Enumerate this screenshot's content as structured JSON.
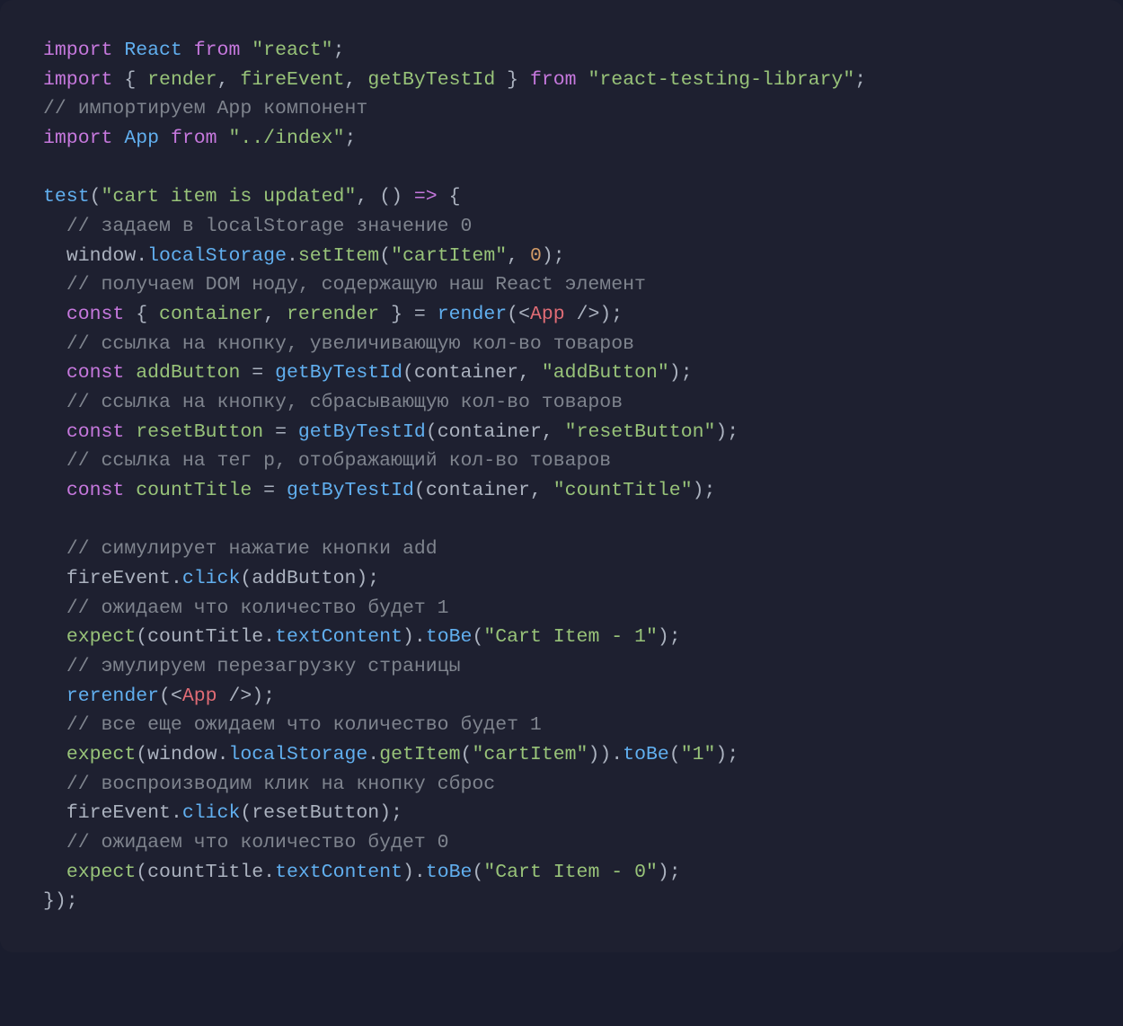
{
  "code": {
    "l1": {
      "kw1": "import",
      "cls": "React",
      "kw2": "from",
      "str": "\"react\"",
      "semi": ";"
    },
    "l2": {
      "kw1": "import",
      "brace_o": "{ ",
      "id1": "render",
      "comma1": ", ",
      "id2": "fireEvent",
      "comma2": ", ",
      "id3": "getByTestId",
      "brace_c": " }",
      "kw2": "from",
      "str": "\"react-testing-library\"",
      "semi": ";"
    },
    "l3": {
      "cmt": "// импортируем App компонент"
    },
    "l4": {
      "kw1": "import",
      "cls": "App",
      "kw2": "from",
      "str": "\"../index\"",
      "semi": ";"
    },
    "l5": {
      "empty": ""
    },
    "l6": {
      "fn": "test",
      "p": "(",
      "str": "\"cart item is updated\"",
      "comma": ", ",
      "paren": "()",
      "arrow": " => ",
      "brace": "{"
    },
    "l7": {
      "indent": "  ",
      "cmt": "// задаем в localStorage значение 0"
    },
    "l8": {
      "indent": "  ",
      "obj": "window",
      "dot1": ".",
      "prop": "localStorage",
      "dot2": ".",
      "meth": "setItem",
      "p": "(",
      "str": "\"cartItem\"",
      "comma": ", ",
      "num": "0",
      "close": ");"
    },
    "l9": {
      "indent": "  ",
      "cmt": "// получаем DOM ноду, содержащую наш React элемент"
    },
    "l10": {
      "indent": "  ",
      "kw": "const",
      "sp": " ",
      "brace_o": "{ ",
      "id1": "container",
      "comma": ", ",
      "id2": "rerender",
      "brace_c": " }",
      "eq": " = ",
      "fn": "render",
      "p": "(",
      "jsx_o": "<",
      "jsx_tag": "App",
      "jsx_c": " />",
      "close": ");"
    },
    "l11": {
      "indent": "  ",
      "cmt": "// ссылка на кнопку, увеличивающую кол-во товаров"
    },
    "l12": {
      "indent": "  ",
      "kw": "const",
      "sp": " ",
      "id": "addButton",
      "eq": " = ",
      "fn": "getByTestId",
      "p": "(",
      "arg": "container",
      "comma": ", ",
      "str": "\"addButton\"",
      "close": ");"
    },
    "l13": {
      "indent": "  ",
      "cmt": "// ссылка на кнопку, сбрасывающую кол-во товаров"
    },
    "l14": {
      "indent": "  ",
      "kw": "const",
      "sp": " ",
      "id": "resetButton",
      "eq": " = ",
      "fn": "getByTestId",
      "p": "(",
      "arg": "container",
      "comma": ", ",
      "str": "\"resetButton\"",
      "close": ");"
    },
    "l15": {
      "indent": "  ",
      "cmt": "// ссылка на тег p, отображающий кол-во товаров"
    },
    "l16": {
      "indent": "  ",
      "kw": "const",
      "sp": " ",
      "id": "countTitle",
      "eq": " = ",
      "fn": "getByTestId",
      "p": "(",
      "arg": "container",
      "comma": ", ",
      "str": "\"countTitle\"",
      "close": ");"
    },
    "l17": {
      "empty": ""
    },
    "l18": {
      "indent": "  ",
      "cmt": "// симулирует нажатие кнопки add"
    },
    "l19": {
      "indent": "  ",
      "obj": "fireEvent",
      "dot": ".",
      "meth": "click",
      "p": "(",
      "arg": "addButton",
      "close": ");"
    },
    "l20": {
      "indent": "  ",
      "cmt": "// ожидаем что количество будет 1"
    },
    "l21": {
      "indent": "  ",
      "fn": "expect",
      "p": "(",
      "arg": "countTitle",
      "dot": ".",
      "prop": "textContent",
      "close1": ")",
      "dot2": ".",
      "meth": "toBe",
      "p2": "(",
      "str": "\"Cart Item - 1\"",
      "close2": ");"
    },
    "l22": {
      "indent": "  ",
      "cmt": "// эмулируем перезагрузку страницы"
    },
    "l23": {
      "indent": "  ",
      "fn": "rerender",
      "p": "(",
      "jsx_o": "<",
      "jsx_tag": "App",
      "jsx_c": " />",
      "close": ");"
    },
    "l24": {
      "indent": "  ",
      "cmt": "// все еще ожидаем что количество будет 1"
    },
    "l25": {
      "indent": "  ",
      "fn": "expect",
      "p": "(",
      "arg": "window",
      "dot": ".",
      "prop": "localStorage",
      "dot2": ".",
      "meth": "getItem",
      "p2": "(",
      "str": "\"cartItem\"",
      "close1": "))",
      "dot3": ".",
      "meth2": "toBe",
      "p3": "(",
      "str2": "\"1\"",
      "close2": ");"
    },
    "l26": {
      "indent": "  ",
      "cmt": "// воспроизводим клик на кнопку сброс"
    },
    "l27": {
      "indent": "  ",
      "obj": "fireEvent",
      "dot": ".",
      "meth": "click",
      "p": "(",
      "arg": "resetButton",
      "close": ");"
    },
    "l28": {
      "indent": "  ",
      "cmt": "// ожидаем что количество будет 0"
    },
    "l29": {
      "indent": "  ",
      "fn": "expect",
      "p": "(",
      "arg": "countTitle",
      "dot": ".",
      "prop": "textContent",
      "close1": ")",
      "dot2": ".",
      "meth": "toBe",
      "p2": "(",
      "str": "\"Cart Item - 0\"",
      "close2": ");"
    },
    "l30": {
      "close": "});"
    }
  }
}
